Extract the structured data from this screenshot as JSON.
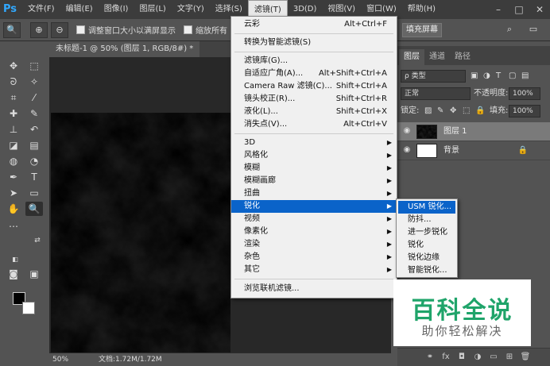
{
  "app": {
    "logo": "Ps"
  },
  "menubar": {
    "items": [
      "文件(F)",
      "编辑(E)",
      "图像(I)",
      "图层(L)",
      "文字(Y)",
      "选择(S)",
      "滤镜(T)",
      "3D(D)",
      "视图(V)",
      "窗口(W)",
      "帮助(H)"
    ],
    "active": "滤镜(T)"
  },
  "window_controls": {
    "minimize": "–",
    "maximize": "□",
    "close": "✕"
  },
  "options_bar": {
    "resize_windows_label": "调整窗口大小以满屏显示",
    "zoom_all_label": "缩放所有",
    "fill_screen_label": "填充屏幕"
  },
  "document": {
    "tab_title": "未标题-1 @ 50% (图层 1, RGB/8#) *",
    "zoom": "50%",
    "info": "文档:1.72M/1.72M"
  },
  "filter_menu": {
    "items": [
      {
        "label": "云彩",
        "shortcut": "Alt+Ctrl+F"
      },
      {
        "label": "转换为智能滤镜(S)",
        "shortcut": ""
      },
      {
        "label": "滤镜库(G)...",
        "shortcut": ""
      },
      {
        "label": "自适应广角(A)...",
        "shortcut": "Alt+Shift+Ctrl+A"
      },
      {
        "label": "Camera Raw 滤镜(C)...",
        "shortcut": "Shift+Ctrl+A"
      },
      {
        "label": "镜头校正(R)...",
        "shortcut": "Shift+Ctrl+R"
      },
      {
        "label": "液化(L)...",
        "shortcut": "Shift+Ctrl+X"
      },
      {
        "label": "消失点(V)...",
        "shortcut": "Alt+Ctrl+V"
      },
      {
        "label": "3D",
        "shortcut": ""
      },
      {
        "label": "风格化",
        "shortcut": ""
      },
      {
        "label": "模糊",
        "shortcut": ""
      },
      {
        "label": "模糊画廊",
        "shortcut": ""
      },
      {
        "label": "扭曲",
        "shortcut": ""
      },
      {
        "label": "锐化",
        "shortcut": ""
      },
      {
        "label": "视频",
        "shortcut": ""
      },
      {
        "label": "像素化",
        "shortcut": ""
      },
      {
        "label": "渲染",
        "shortcut": ""
      },
      {
        "label": "杂色",
        "shortcut": ""
      },
      {
        "label": "其它",
        "shortcut": ""
      },
      {
        "label": "浏览联机滤镜...",
        "shortcut": ""
      }
    ],
    "highlighted": "锐化"
  },
  "sharpen_submenu": {
    "items": [
      "USM 锐化...",
      "防抖...",
      "进一步锐化",
      "锐化",
      "锐化边缘",
      "智能锐化..."
    ],
    "highlighted": "USM 锐化..."
  },
  "layers_panel": {
    "tabs": [
      "图层",
      "通道",
      "路径"
    ],
    "active_tab": "图层",
    "filter_kind": "ρ 类型",
    "blend_mode": "正常",
    "opacity_label": "不透明度:",
    "opacity_value": "100%",
    "lock_label": "锁定:",
    "fill_label": "填充:",
    "fill_value": "100%",
    "layers": [
      {
        "name": "图层 1",
        "selected": true
      },
      {
        "name": "背景",
        "selected": false
      }
    ]
  },
  "watermark": {
    "title": "百科全说",
    "subtitle": "助你轻松解决"
  }
}
